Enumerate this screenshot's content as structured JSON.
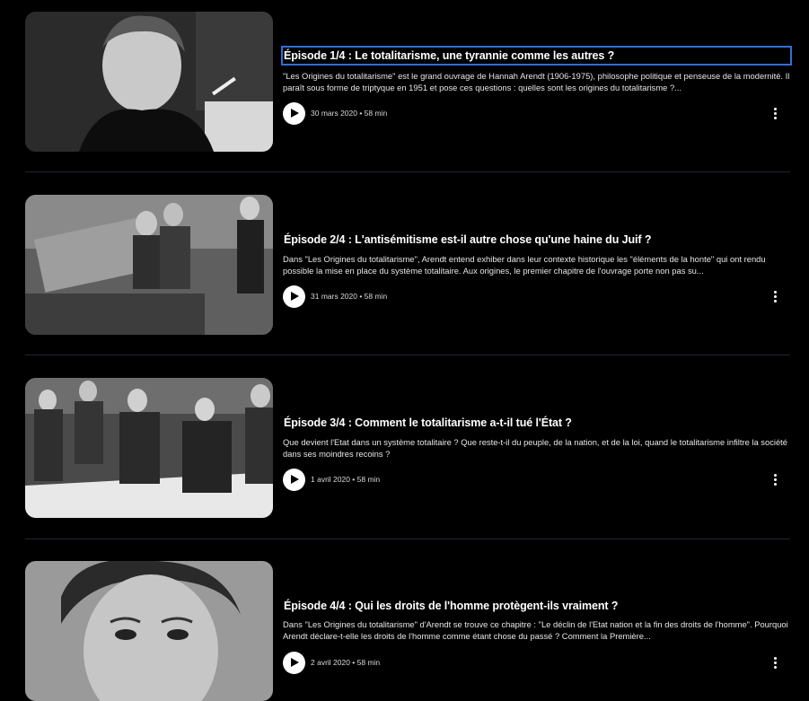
{
  "colors": {
    "background": "#000000",
    "focus_outline": "#2f6fd6",
    "divider": "#22232e"
  },
  "episodes": [
    {
      "title": "Épisode 1/4 : Le totalitarisme, une tyrannie comme les autres ?",
      "description": "\"Les Origines du totalitarisme\" est le grand ouvrage de Hannah Arendt (1906-1975), philosophe politique et penseuse de la modernité. Il paraît sous forme de triptyque en 1951 et pose ces questions : quelles sont les origines du totalitarisme ?...",
      "meta": "30 mars 2020 • 58 min",
      "thumbnail": "portrait-smoking-woman"
    },
    {
      "title": "Épisode 2/4 : L'antisémitisme est-il autre chose qu'une haine du Juif ?",
      "description": "Dans \"Les Origines du totalitarisme\", Arendt entend exhiber dans leur contexte historique les \"éléments de la honte\" qui ont rendu possible la mise en place du système totalitaire. Aux origines, le premier chapitre de l'ouvrage porte non pas su...",
      "meta": "31 mars 2020 • 58 min",
      "thumbnail": "bench-scene"
    },
    {
      "title": "Épisode 3/4 : Comment le totalitarisme a-t-il tué l'État ?",
      "description": "Que devient l'Etat dans un système totalitaire ? Que reste-t-il du peuple, de la nation, et de la loi, quand le totalitarisme infiltre la société dans ses moindres recoins ?",
      "meta": "1 avril 2020 • 58 min",
      "thumbnail": "officers-map-table"
    },
    {
      "title": "Épisode 4/4 : Qui les droits de l'homme protègent-ils vraiment ?",
      "description": "Dans \"Les Origines du totalitarisme\" d'Arendt se trouve ce chapitre : \"Le déclin de l'Etat nation et la fin des droits de l'homme\". Pourquoi Arendt déclare-t-elle les droits de l'homme comme étant chose du passé ? Comment la Première...",
      "meta": "2 avril 2020 • 58 min",
      "thumbnail": "portrait-woman-closeup"
    }
  ]
}
